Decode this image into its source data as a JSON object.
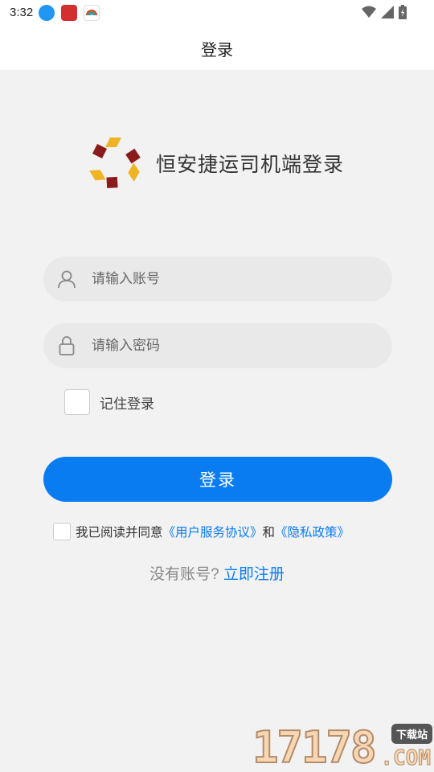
{
  "status_bar": {
    "time": "3:32",
    "apps": [
      "download-icon",
      "app-red-icon",
      "app-rainbow-icon"
    ],
    "right_icons": [
      "wifi-icon",
      "signal-icon",
      "battery-icon"
    ]
  },
  "header": {
    "title": "登录"
  },
  "brand": {
    "logo": "app-logo",
    "title": "恒安捷运司机端登录"
  },
  "form": {
    "account_placeholder": "请输入账号",
    "password_placeholder": "请输入密码",
    "remember_label": "记住登录",
    "login_label": "登录"
  },
  "agreement": {
    "prefix": "我已阅读并同意",
    "user_agreement": "《用户服务协议》",
    "conjunction": "和",
    "privacy_policy": "《隐私政策》"
  },
  "register": {
    "prompt": "没有账号?",
    "link": "立即注册"
  },
  "watermark": {
    "digits": "17178",
    "com": ".COM",
    "badge": "下载站"
  },
  "colors": {
    "primary": "#0a7cf2",
    "background": "#f2f2f2",
    "field": "#e9e9e9",
    "logo_dark": "#8b1a1a",
    "logo_gold": "#f0b323"
  }
}
